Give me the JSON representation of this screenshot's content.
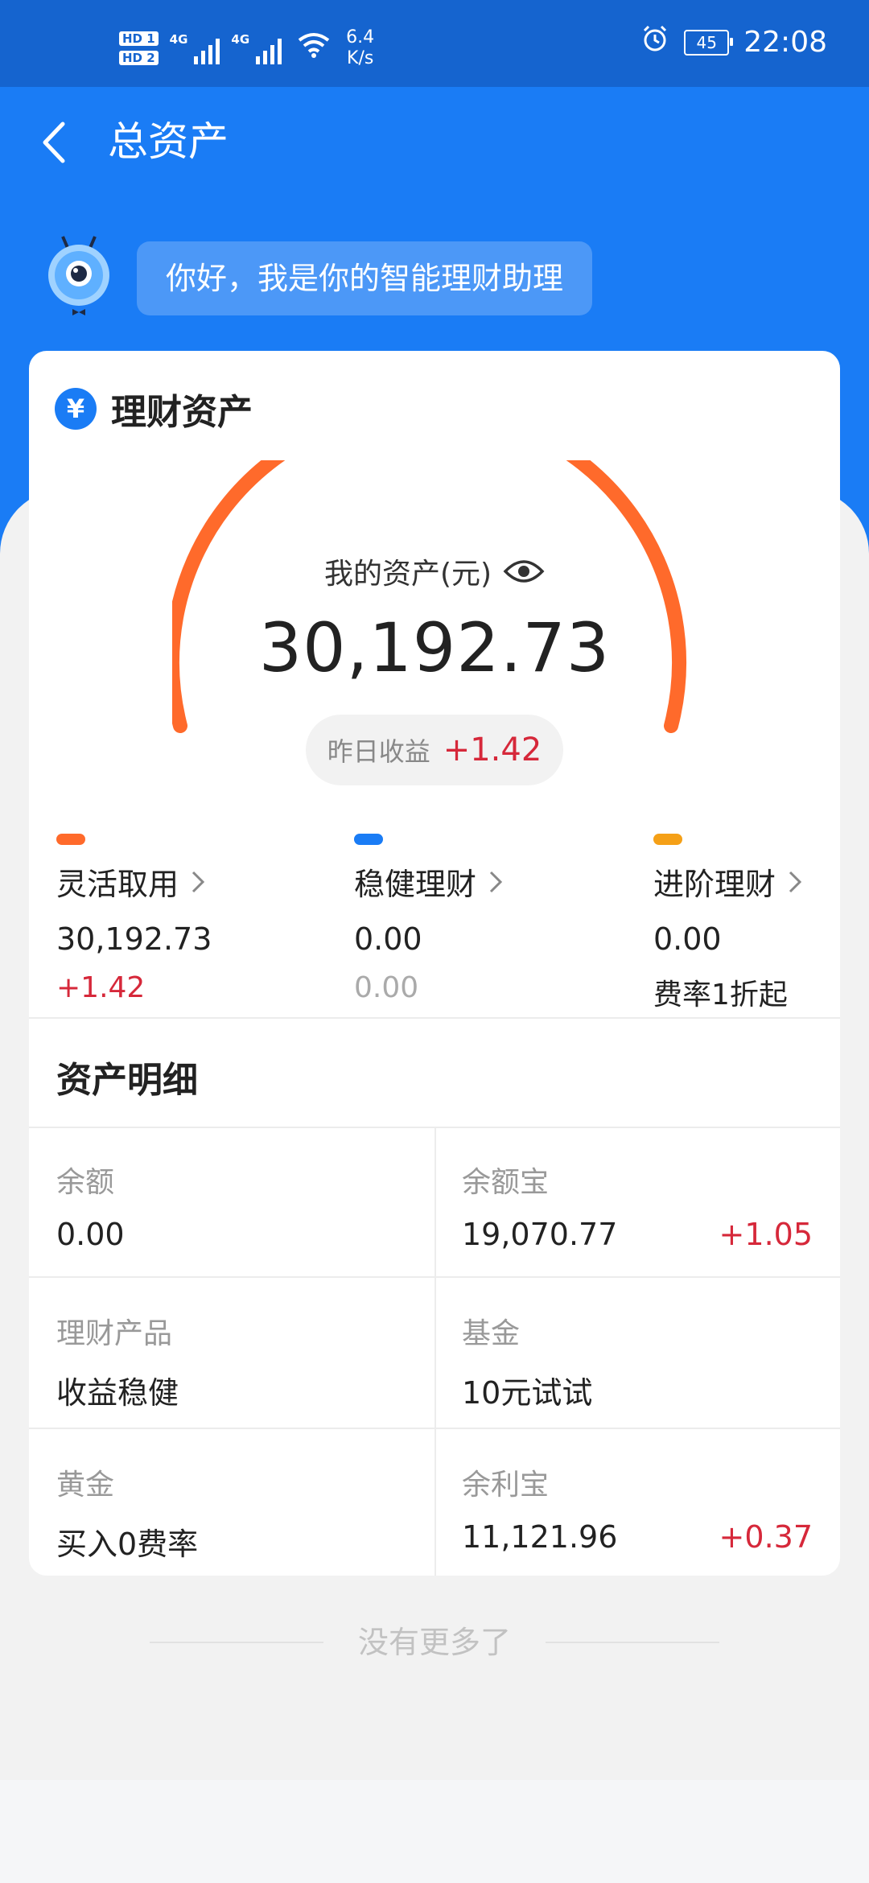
{
  "status_bar": {
    "hd1": "HD 1",
    "hd2": "HD 2",
    "net1": "4G",
    "net2": "4G",
    "speed_value": "6.4",
    "speed_unit": "K/s",
    "battery": "45",
    "time": "22:08",
    "icons": [
      "alarm-icon",
      "wifi-icon",
      "signal-icon",
      "battery-icon"
    ]
  },
  "header": {
    "title": "总资产",
    "back_icon": "chevron-left-icon"
  },
  "assistant": {
    "greeting": "你好，我是你的智能理财助理",
    "avatar_icon": "robot-mascot-icon"
  },
  "card": {
    "title": "理财资产",
    "icon": "yen-icon",
    "my_assets_label": "我的资产(元)",
    "total": "30,192.73",
    "yesterday_label": "昨日收益",
    "yesterday_value": "+1.42",
    "categories": [
      {
        "color": "#ff6a2b",
        "name": "灵活取用",
        "value": "30,192.73",
        "sub": "+1.42"
      },
      {
        "color": "#1a7cf5",
        "name": "稳健理财",
        "value": "0.00",
        "sub": "0.00"
      },
      {
        "color": "#f5a017",
        "name": "进阶理财",
        "value": "0.00",
        "sub": "费率1折起"
      }
    ]
  },
  "detail": {
    "title": "资产明细",
    "items": [
      {
        "label": "余额",
        "value": "0.00",
        "change": ""
      },
      {
        "label": "余额宝",
        "value": "19,070.77",
        "change": "+1.05"
      },
      {
        "label": "理财产品",
        "value": "收益稳健",
        "change": ""
      },
      {
        "label": "基金",
        "value": "10元试试",
        "change": ""
      },
      {
        "label": "黄金",
        "value": "买入0费率",
        "change": ""
      },
      {
        "label": "余利宝",
        "value": "11,121.96",
        "change": "+0.37"
      }
    ]
  },
  "footer": {
    "end_note": "没有更多了"
  },
  "colors": {
    "primary": "#1a7cf5",
    "status_bar": "#1564cf",
    "gauge": "#ff6a2b",
    "gain": "#d6283a"
  }
}
